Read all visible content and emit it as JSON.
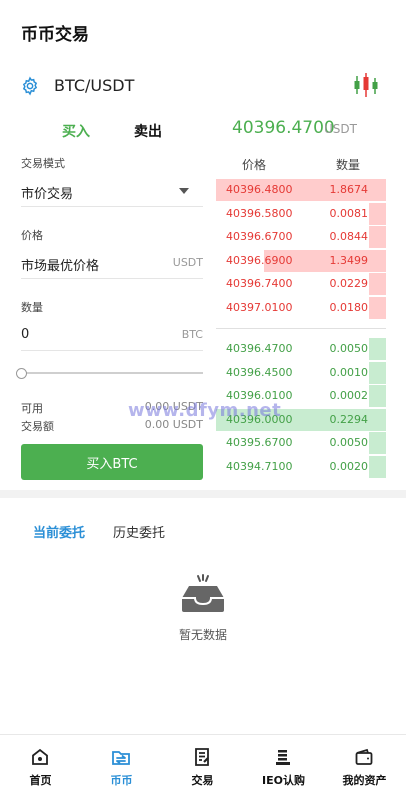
{
  "header": {
    "title": "币币交易"
  },
  "pair": {
    "name": "BTC/USDT"
  },
  "tabs": {
    "buy": "买入",
    "sell": "卖出"
  },
  "ticker": {
    "last_price": "40396.4700",
    "unit": "USDT"
  },
  "form": {
    "mode_label": "交易模式",
    "mode_value": "市价交易",
    "price_label": "价格",
    "price_value": "市场最优价格",
    "price_unit": "USDT",
    "qty_label": "数量",
    "qty_value": "0",
    "qty_unit": "BTC",
    "slider_percent": 0,
    "available_label": "可用",
    "available_value": "0.00 USDT",
    "amount_label": "交易额",
    "amount_value": "0.00 USDT",
    "submit_label": "买入BTC"
  },
  "orderbook": {
    "price_header": "价格",
    "qty_header": "数量",
    "asks": [
      {
        "price": "40396.4800",
        "qty": "1.8674",
        "depth": 1.0
      },
      {
        "price": "40396.5800",
        "qty": "0.0081",
        "depth": 0.1
      },
      {
        "price": "40396.6700",
        "qty": "0.0844",
        "depth": 0.1
      },
      {
        "price": "40396.6900",
        "qty": "1.3499",
        "depth": 0.72
      },
      {
        "price": "40396.7400",
        "qty": "0.0229",
        "depth": 0.1
      },
      {
        "price": "40397.0100",
        "qty": "0.0180",
        "depth": 0.1
      }
    ],
    "bids": [
      {
        "price": "40396.4700",
        "qty": "0.0050",
        "depth": 0.1
      },
      {
        "price": "40396.4500",
        "qty": "0.0010",
        "depth": 0.1
      },
      {
        "price": "40396.0100",
        "qty": "0.0002",
        "depth": 0.1
      },
      {
        "price": "40396.0000",
        "qty": "0.2294",
        "depth": 1.0
      },
      {
        "price": "40395.6700",
        "qty": "0.0050",
        "depth": 0.1
      },
      {
        "price": "40394.7100",
        "qty": "0.0020",
        "depth": 0.1
      }
    ]
  },
  "watermark": "www.dfym.net",
  "orders": {
    "current_tab": "当前委托",
    "history_tab": "历史委托",
    "empty_text": "暂无数据"
  },
  "nav": [
    {
      "label": "首页",
      "icon": "home-icon"
    },
    {
      "label": "币币",
      "icon": "folder-swap-icon"
    },
    {
      "label": "交易",
      "icon": "trade-doc-icon"
    },
    {
      "label": "IEO认购",
      "icon": "coin-stack-icon"
    },
    {
      "label": "我的资产",
      "icon": "wallet-icon"
    }
  ],
  "colors": {
    "buy_green": "#4caf50",
    "sell_red": "#e53935",
    "active_blue": "#2b8fd6"
  }
}
